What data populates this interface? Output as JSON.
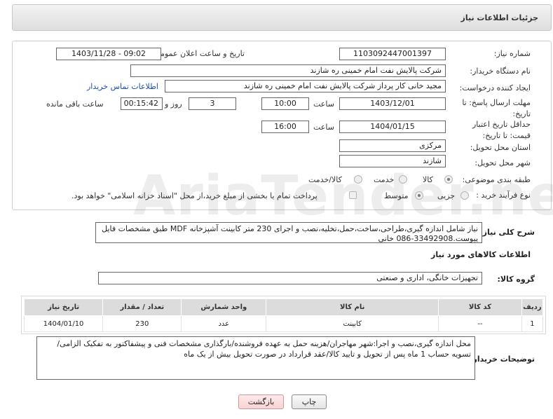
{
  "header": {
    "title": "جزئیات اطلاعات نیاز"
  },
  "form": {
    "need_number_label": "شماره نیاز:",
    "need_number": "1103092447001397",
    "announce_label": "تاریخ و ساعت اعلان عمومی:",
    "announce_value": "1403/11/28 - 09:02",
    "buyer_org_label": "نام دستگاه خریدار:",
    "buyer_org": "شرکت پالایش نفت امام خمینی  ره  شازند",
    "requester_label": "ایجاد کننده درخواست:",
    "requester": "مجید خانی کار پرداز شرکت پالایش نفت امام خمینی  ره  شازند",
    "contact_link": "اطلاعات تماس خریدار",
    "reply_deadline_label": "مهلت ارسال پاسخ: تا تاریخ:",
    "reply_date": "1403/12/01",
    "time_label": "ساعت",
    "reply_time": "10:00",
    "days_value": "3",
    "days_label": "روز و",
    "remaining_time": "00:15:42",
    "remaining_label": "ساعت باقی مانده",
    "price_validity_label": "حداقل تاریخ اعتبار قیمت: تا تاریخ:",
    "price_date": "1404/01/15",
    "price_time": "16:00",
    "province_label": "استان محل تحویل:",
    "province": "مرکزی",
    "city_label": "شهر محل تحویل:",
    "city": "شازند",
    "category_label": "طبقه بندی موضوعی:",
    "category_options": [
      "کالا",
      "خدمت",
      "کالا/خدمت"
    ],
    "category_selected": "کالا",
    "process_label": "نوع فرآیند خرید :",
    "process_options": [
      "جزیی",
      "متوسط"
    ],
    "process_selected": "متوسط",
    "payment_note": "پرداخت تمام یا بخشی از مبلغ خرید،از محل \"اسناد خزانه اسلامی\" خواهد بود."
  },
  "description": {
    "label": "شرح کلی نیاز:",
    "text": "نیاز شامل اندازه گیری،طراحی،ساخت،حمل،تخلیه،نصب و اجرای 230 متر کابینت آشپزخانه MDF طبق مشخصات فایل پیوست.33492908-086 خانی"
  },
  "goods_section": {
    "title": "اطلاعات کالاهای مورد نیاز",
    "group_label": "گروه کالا:",
    "group_value": "تجهیزات خانگی، اداری و صنعتی"
  },
  "table": {
    "headers": [
      "ردیف",
      "کد کالا",
      "نام کالا",
      "واحد شمارش",
      "تعداد / مقدار",
      "تاریخ نیاز"
    ],
    "rows": [
      [
        "1",
        "--",
        "کابینت",
        "عدد",
        "230",
        "1404/01/10"
      ]
    ]
  },
  "buyer_notes": {
    "label": "توضیحات خریدار:",
    "text": "محل اندازه گیری،نصب و اجرا:شهر مهاجران/هزینه حمل به عهده فروشنده/بارگذاری مشخصات فنی و پیشفاکتور به تفکیک الزامی/تسویه حساب 1 ماه پس از تحویل و تایید کالا/عقد قرارداد در صورت تحویل بیش از یک ماه"
  },
  "buttons": {
    "print": "چاپ",
    "back": "بازگشت"
  },
  "watermark": "AriaTender.neT",
  "colors": {
    "link": "#1a4fb4",
    "header_bg": "#e6e6e6",
    "back_button": "#f7d3d5"
  }
}
